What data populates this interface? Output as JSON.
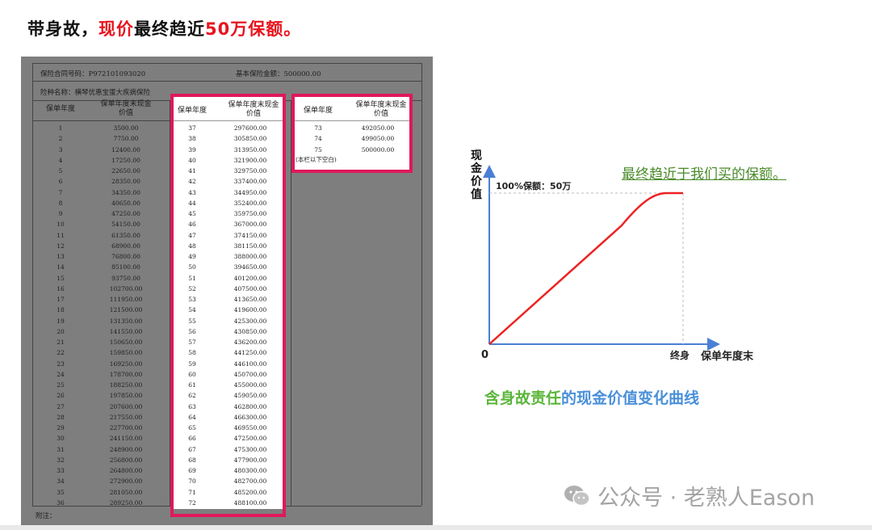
{
  "headline": {
    "part1": "带身故，",
    "part2": "现价",
    "part3": "最终趋近",
    "part4": "50万保额。"
  },
  "policy": {
    "contract_label": "保险合同号码：",
    "contract_no": "P972101093020",
    "amount_label": "基本保险金额：",
    "amount": "500000.00",
    "product_label": "险种名称：",
    "product": "横琴优惠宝蛋大疾病保险",
    "col_year": "保单年度",
    "col_value": "保单年度末现金价值",
    "col1_years": [
      "1",
      "2",
      "3",
      "4",
      "5",
      "6",
      "7",
      "8",
      "9",
      "10",
      "11",
      "12",
      "13",
      "14",
      "15",
      "16",
      "17",
      "18",
      "19",
      "20",
      "21",
      "22",
      "23",
      "24",
      "25",
      "26",
      "27",
      "28",
      "29",
      "30",
      "31",
      "32",
      "33",
      "34",
      "35",
      "36"
    ],
    "col1_values": [
      "3500.00",
      "7750.00",
      "12400.00",
      "17250.00",
      "22650.00",
      "28350.00",
      "34350.00",
      "40650.00",
      "47250.00",
      "54150.00",
      "61350.00",
      "68900.00",
      "76800.00",
      "85100.00",
      "93750.00",
      "102700.00",
      "111950.00",
      "121500.00",
      "131350.00",
      "141550.00",
      "150650.00",
      "159850.00",
      "169250.00",
      "178700.00",
      "188250.00",
      "197850.00",
      "207600.00",
      "217550.00",
      "227700.00",
      "241150.00",
      "248900.00",
      "256800.00",
      "264800.00",
      "272900.00",
      "281050.00",
      "289250.00"
    ],
    "col2_years": [
      "37",
      "38",
      "39",
      "40",
      "41",
      "42",
      "43",
      "44",
      "45",
      "46",
      "47",
      "48",
      "49",
      "50",
      "51",
      "52",
      "53",
      "54",
      "55",
      "56",
      "57",
      "58",
      "59",
      "60",
      "61",
      "62",
      "63",
      "64",
      "65",
      "66",
      "67",
      "68",
      "69",
      "70",
      "71",
      "72"
    ],
    "col2_values": [
      "297600.00",
      "305850.00",
      "313950.00",
      "321900.00",
      "329750.00",
      "337400.00",
      "344950.00",
      "352400.00",
      "359750.00",
      "367000.00",
      "374150.00",
      "381150.00",
      "388000.00",
      "394650.00",
      "401200.00",
      "407500.00",
      "413650.00",
      "419600.00",
      "425300.00",
      "430850.00",
      "436200.00",
      "441250.00",
      "446100.00",
      "450700.00",
      "455000.00",
      "459050.00",
      "462800.00",
      "466300.00",
      "469550.00",
      "472500.00",
      "475300.00",
      "477900.00",
      "480300.00",
      "482700.00",
      "485200.00",
      "488100.00"
    ],
    "col3_years": [
      "73",
      "74",
      "75"
    ],
    "col3_values": [
      "492050.00",
      "499050.00",
      "500000.00"
    ],
    "blank_note": "(本栏以下空白)",
    "footnote": "附注："
  },
  "chart": {
    "ylabel": "现金价值",
    "xlabel": "保单年度末",
    "origin": "0",
    "end_label": "终身",
    "cap_label": "100%保额：50万",
    "note": "最终趋近于我们买的保额。",
    "caption_green": "含身故责任",
    "caption_blue": "的现金价值变化曲线"
  },
  "chart_data": {
    "type": "line",
    "xlabel": "保单年度末",
    "ylabel": "现金价值",
    "categories": [
      "0",
      "终身"
    ],
    "series": [
      {
        "values": [
          0,
          500000
        ]
      }
    ]
  },
  "watermark": {
    "text": "公众号 · 老熟人Eason",
    "icon": "wechat-icon"
  }
}
